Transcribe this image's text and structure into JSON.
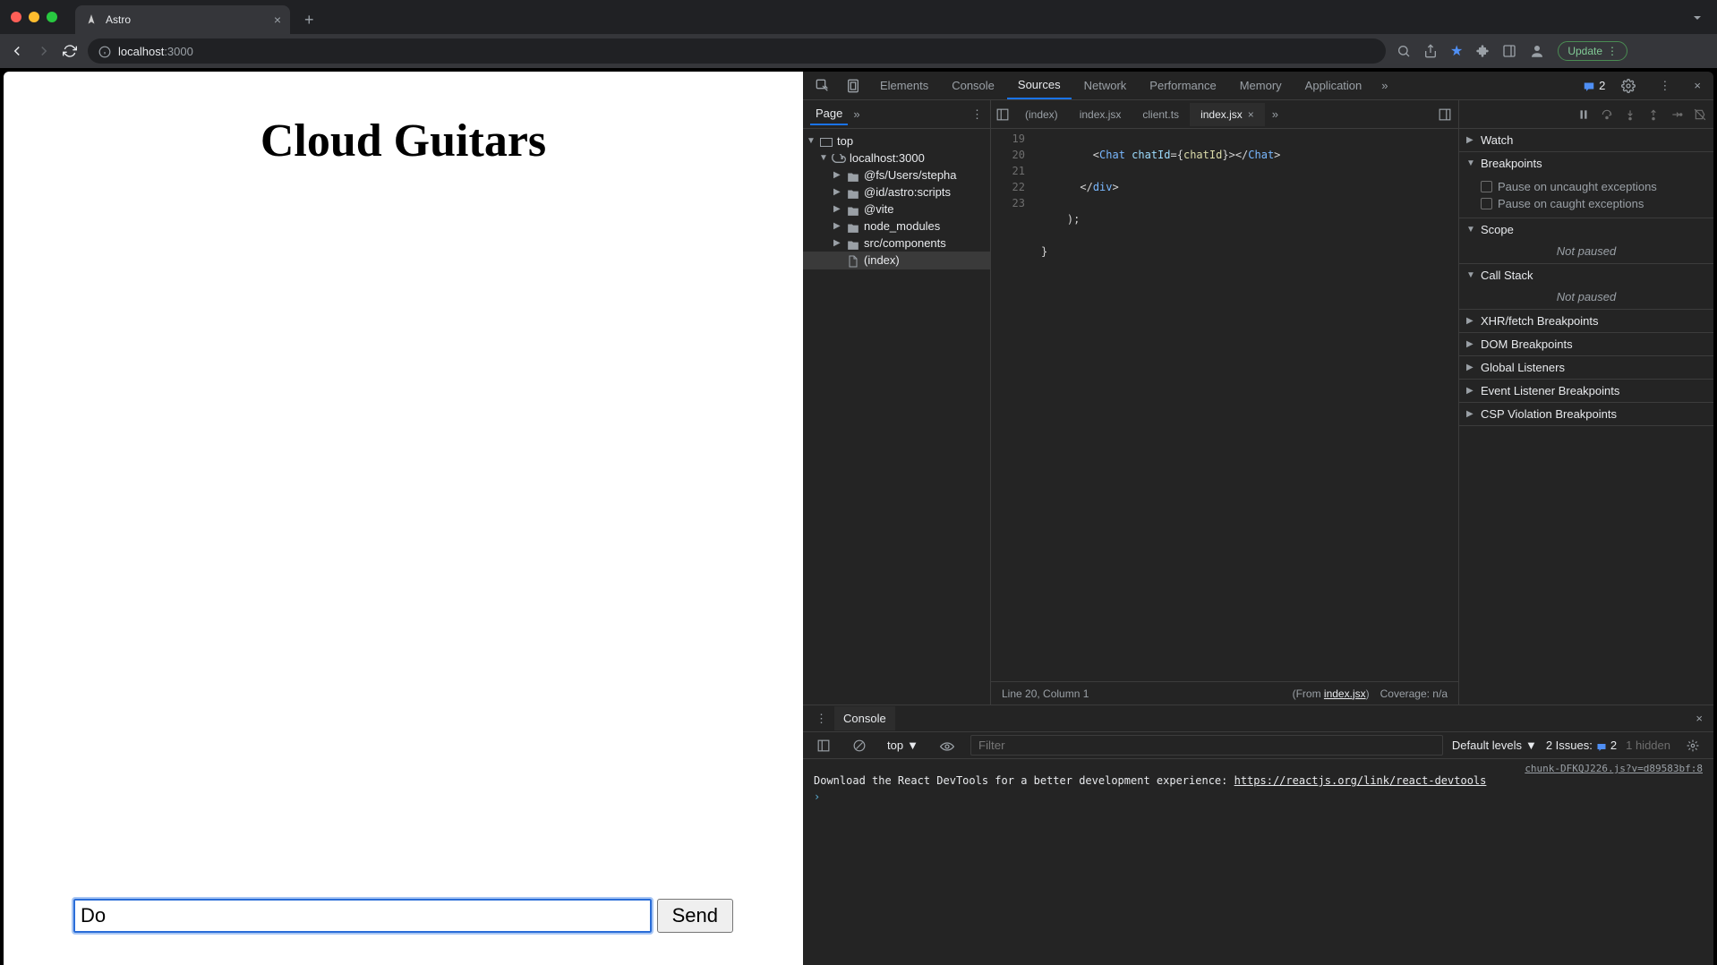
{
  "browser": {
    "tab_title": "Astro",
    "url_main": "localhost",
    "url_rest": ":3000",
    "update_label": "Update"
  },
  "page": {
    "heading": "Cloud Guitars",
    "chat_input_value": "Do",
    "send_label": "Send"
  },
  "devtools": {
    "tabs": [
      "Elements",
      "Console",
      "Sources",
      "Network",
      "Performance",
      "Memory",
      "Application"
    ],
    "active_tab": "Sources",
    "issues_count": "2"
  },
  "file_nav": {
    "header_tab": "Page",
    "tree": {
      "top": "top",
      "host": "localhost:3000",
      "folders": [
        "@fs/Users/stepha",
        "@id/astro:scripts",
        "@vite",
        "node_modules",
        "src/components"
      ],
      "index_file": "(index)"
    }
  },
  "editor": {
    "tabs": [
      "(index)",
      "index.jsx",
      "client.ts",
      "index.jsx"
    ],
    "active_tab_index": 3,
    "gutter": [
      "19",
      "20",
      "21",
      "22",
      "23"
    ],
    "code": {
      "l19_a": "<",
      "l19_b": "Chat",
      "l19_c": " chatId",
      "l19_d": "=",
      "l19_e": "{",
      "l19_f": "chatId",
      "l19_g": "}",
      "l19_h": ">",
      "l19_i": "</",
      "l19_j": "Chat",
      "l19_k": ">",
      "l20_a": "</",
      "l20_b": "div",
      "l20_c": ">",
      "l21": ");",
      "l22": "}"
    },
    "status_line": "Line 20, Column 1",
    "status_from_prefix": "(From ",
    "status_from_link": "index.jsx",
    "status_from_suffix": ")",
    "status_coverage": "Coverage: n/a"
  },
  "debugger": {
    "sections": {
      "watch": "Watch",
      "breakpoints": "Breakpoints",
      "bp_uncaught": "Pause on uncaught exceptions",
      "bp_caught": "Pause on caught exceptions",
      "scope": "Scope",
      "scope_msg": "Not paused",
      "callstack": "Call Stack",
      "callstack_msg": "Not paused",
      "xhr": "XHR/fetch Breakpoints",
      "dom": "DOM Breakpoints",
      "global": "Global Listeners",
      "event": "Event Listener Breakpoints",
      "csp": "CSP Violation Breakpoints"
    }
  },
  "console": {
    "tab_label": "Console",
    "context": "top",
    "filter_placeholder": "Filter",
    "levels_label": "Default levels",
    "issues_label": "2 Issues:",
    "issues_count": "2",
    "hidden_label": "1 hidden",
    "source_link": "chunk-DFKQJ226.js?v=d89583bf:8",
    "message": "Download the React DevTools for a better development experience: ",
    "message_link": "https://reactjs.org/link/react-devtools"
  }
}
